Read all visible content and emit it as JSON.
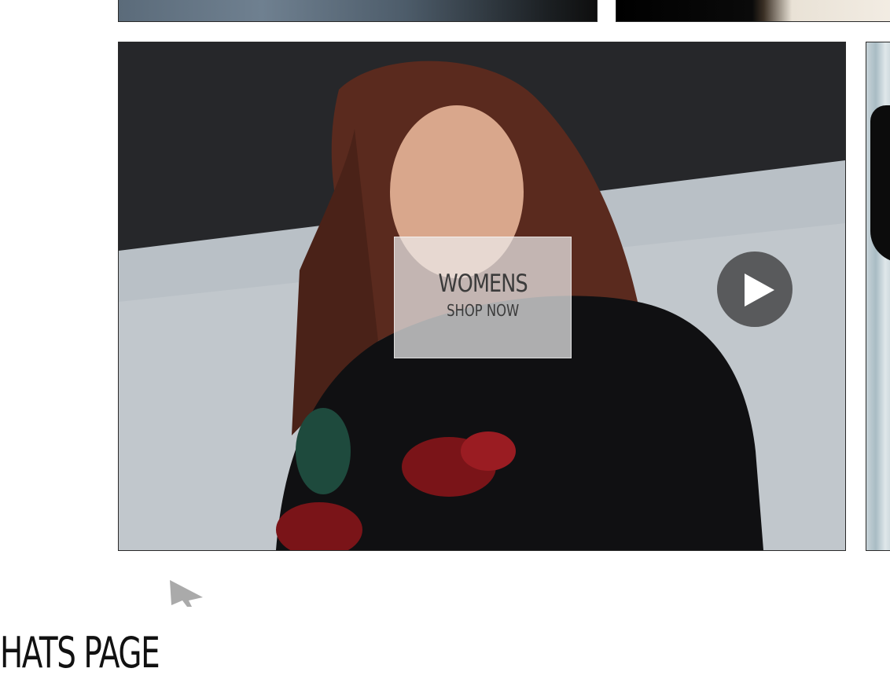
{
  "main_tile": {
    "title": "WOMENS",
    "subtitle": "SHOP NOW",
    "play_icon": "play-icon"
  },
  "page_heading": "HATS PAGE",
  "colors": {
    "overlay_box": "#ebebeb",
    "text": "#3b3b3b",
    "play_button_bg": "#464648",
    "play_icon": "#ffffff",
    "heading": "#111111"
  }
}
